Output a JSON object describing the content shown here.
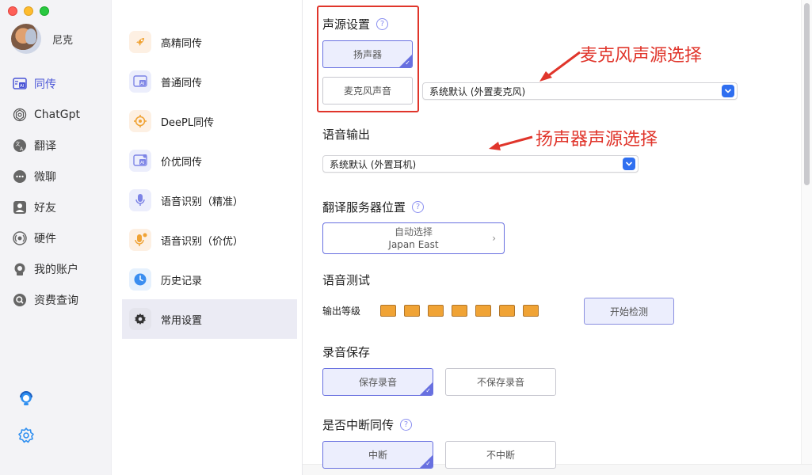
{
  "profile": {
    "name": "尼克"
  },
  "sidebar": {
    "items": [
      {
        "label": "同传",
        "icon": "ai-translate-icon",
        "active": true
      },
      {
        "label": "ChatGpt",
        "icon": "openai-icon",
        "active": false
      },
      {
        "label": "翻译",
        "icon": "translate-icon",
        "active": false
      },
      {
        "label": "微聊",
        "icon": "chat-icon",
        "active": false
      },
      {
        "label": "好友",
        "icon": "friend-icon",
        "active": false
      },
      {
        "label": "硬件",
        "icon": "hardware-icon",
        "active": false
      },
      {
        "label": "我的账户",
        "icon": "account-icon",
        "active": false
      },
      {
        "label": "资费查询",
        "icon": "search-icon",
        "active": false
      }
    ],
    "bottom_icons": [
      "support-icon",
      "settings-icon"
    ]
  },
  "midlist": {
    "items": [
      {
        "label": "高精同传",
        "icon": "rocket-icon",
        "active": false
      },
      {
        "label": "普通同传",
        "icon": "ai-translate-icon",
        "active": false
      },
      {
        "label": "DeePL同传",
        "icon": "target-icon",
        "active": false
      },
      {
        "label": "价优同传",
        "icon": "ai-translate-icon",
        "active": false
      },
      {
        "label": "语音识别（精准）",
        "icon": "microphone-icon",
        "active": false
      },
      {
        "label": "语音识别（价优）",
        "icon": "microphone-icon",
        "active": false
      },
      {
        "label": "历史记录",
        "icon": "clock-icon",
        "active": false
      },
      {
        "label": "常用设置",
        "icon": "gear-icon",
        "active": true
      }
    ]
  },
  "settings": {
    "audio_source": {
      "title": "声源设置",
      "speaker_label": "扬声器",
      "mic_label": "麦克风声音",
      "mic_select_value": "系统默认 (外置麦克风)"
    },
    "voice_output": {
      "title": "语音输出",
      "select_value": "系统默认 (外置耳机)"
    },
    "server": {
      "title": "翻译服务器位置",
      "line1": "自动选择",
      "line2": "Japan East"
    },
    "voice_test": {
      "title": "语音测试",
      "level_label": "输出等级",
      "start_label": "开始检测",
      "segments": 7
    },
    "recording": {
      "title": "录音保存",
      "save_label": "保存录音",
      "nosave_label": "不保存录音"
    },
    "interrupt": {
      "title": "是否中断同传",
      "interrupt_label": "中断",
      "nointerrupt_label": "不中断"
    }
  },
  "annotations": {
    "mic": "麦克风声源选择",
    "speaker": "扬声器声源选择"
  },
  "colors": {
    "accent": "#4a55d6",
    "annotation": "#e0352b",
    "meter": "#f0a335"
  }
}
